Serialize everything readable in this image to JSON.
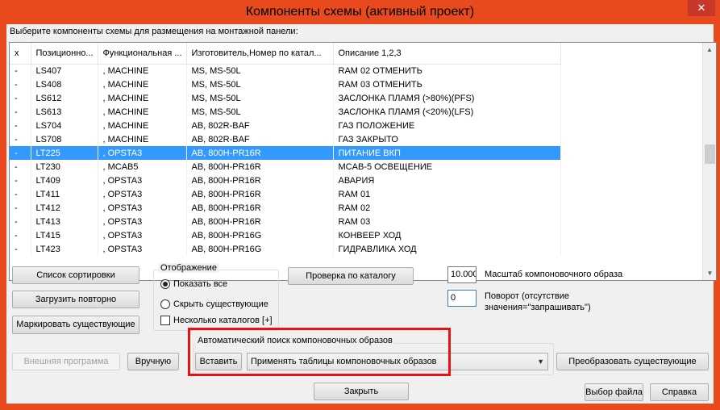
{
  "window": {
    "title": "Компоненты схемы (активный проект)",
    "close_glyph": "✕"
  },
  "prompt": "Выберите компоненты схемы для размещения на монтажной панели:",
  "table": {
    "columns": [
      "x",
      "Позиционно...",
      "Функциональная ...",
      "Изготовитель,Номер по катал...",
      "Описание 1,2,3"
    ],
    "rows": [
      [
        "-",
        "LS407",
        ", MACHINE",
        "MS, MS-50L",
        "RAM 02 ОТМЕНИТЬ"
      ],
      [
        "-",
        "LS408",
        ", MACHINE",
        "MS, MS-50L",
        "RAM 03 ОТМЕНИТЬ"
      ],
      [
        "-",
        "LS612",
        ", MACHINE",
        "MS, MS-50L",
        "ЗАСЛОНКА ПЛАМЯ (>80%)(PFS)"
      ],
      [
        "-",
        "LS613",
        ", MACHINE",
        "MS, MS-50L",
        "ЗАСЛОНКА ПЛАМЯ (<20%)(LFS)"
      ],
      [
        "-",
        "LS704",
        ", MACHINE",
        "AB, 802R-BAF",
        "ГАЗ ПОЛОЖЕНИЕ"
      ],
      [
        "-",
        "LS708",
        ", MACHINE",
        "AB, 802R-BAF",
        "ГАЗ ЗАКРЫТО"
      ],
      [
        "-",
        "LT225",
        ", OPSTA3",
        "AB, 800H-PR16R",
        "ПИТАНИЕ ВКП"
      ],
      [
        "-",
        "LT230",
        ", MCAB5",
        "AB, 800H-PR16R",
        "MCAB-5 ОСВЕЩЕНИЕ"
      ],
      [
        "-",
        "LT409",
        ", OPSTA3",
        "AB, 800H-PR16R",
        "АВАРИЯ"
      ],
      [
        "-",
        "LT411",
        ", OPSTA3",
        "AB, 800H-PR16R",
        "RAM 01"
      ],
      [
        "-",
        "LT412",
        ", OPSTA3",
        "AB, 800H-PR16R",
        "RAM 02"
      ],
      [
        "-",
        "LT413",
        ", OPSTA3",
        "AB, 800H-PR16R",
        "RAM 03"
      ],
      [
        "-",
        "LT415",
        ", OPSTA3",
        "AB, 800H-PR16G",
        "КОНВЕЕР ХОД"
      ],
      [
        "-",
        "LT423",
        ", OPSTA3",
        "AB, 800H-PR16G",
        "ГИДРАВЛИКА ХОД"
      ]
    ],
    "selected_row": 6
  },
  "buttons": {
    "sort": "Список сортировки",
    "reload": "Загрузить повторно",
    "mark": "Маркировать существующие",
    "external": "Внешняя программа",
    "manual": "Вручную",
    "check_catalog": "Проверка по каталогу",
    "insert": "Вставить",
    "convert": "Преобразовать существующие",
    "close": "Закрыть",
    "file": "Выбор файла",
    "help": "Справка"
  },
  "display": {
    "label": "Отображение",
    "show_all": "Показать все",
    "hide_existing": "Скрыть существующие",
    "multi_catalog": "Несколько каталогов [+]",
    "selected": "show_all"
  },
  "scale": {
    "value": "10.000",
    "label": "Масштаб компоновочного образа"
  },
  "rotation": {
    "value": "0",
    "label": "Поворот (отсутствие значения=\"запрашивать\")"
  },
  "auto_search": {
    "label": "Автоматический поиск компоновочных образов",
    "combo_value": "Применять таблицы компоновочных образов"
  },
  "colors": {
    "selection": "#3399ff",
    "highlight_box": "#e81212",
    "title_bar": "#e8491d"
  }
}
